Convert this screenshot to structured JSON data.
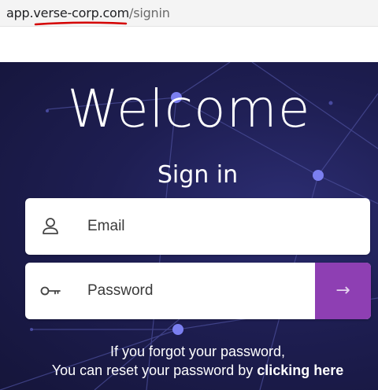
{
  "browser": {
    "url_domain": "app.verse-corp.com",
    "url_path": "/signin"
  },
  "hero": {
    "title": "Welcome",
    "subtitle": "Sign in"
  },
  "form": {
    "email_placeholder": "Email",
    "password_placeholder": "Password",
    "submit_icon": "arrow-right-icon"
  },
  "help": {
    "line1": "If you forgot your password,",
    "line2_prefix": "You can reset your password by",
    "link_text": "clicking here"
  },
  "colors": {
    "background": "#1e1e52",
    "accent": "#8e3fb3",
    "url_underline": "#d40000"
  }
}
